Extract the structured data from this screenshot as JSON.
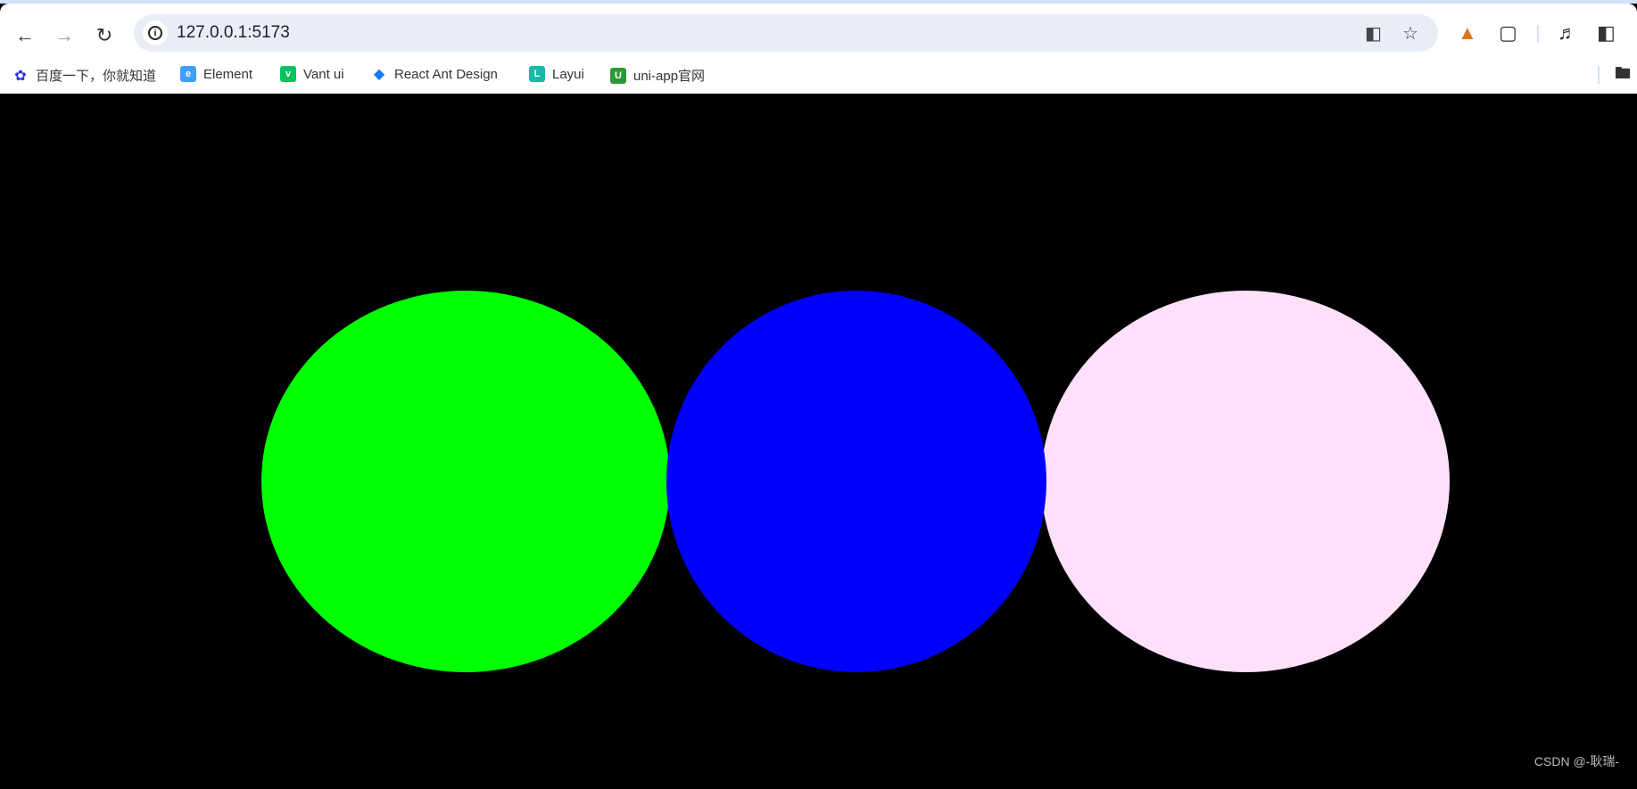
{
  "browser": {
    "url": "127.0.0.1:5173",
    "bookmarks": [
      {
        "label": "百度一下，你就知道",
        "icon": "baidu-icon",
        "color": "#2932e1"
      },
      {
        "label": "Element",
        "icon": "element-icon",
        "color": "#409eff"
      },
      {
        "label": "Vant ui",
        "icon": "vant-icon",
        "color": "#07c160"
      },
      {
        "label": "React Ant Design",
        "icon": "antd-icon",
        "color": "#1677ff"
      },
      {
        "label": "Layui",
        "icon": "layui-icon",
        "color": "#16baaa"
      },
      {
        "label": "uni-app官网",
        "icon": "uniapp-icon",
        "color": "#2b9939"
      }
    ]
  },
  "scene": {
    "background": "#000000",
    "circles": [
      {
        "name": "green-circle",
        "color": "#00ff00"
      },
      {
        "name": "pink-circle",
        "color": "#ffe0fa"
      },
      {
        "name": "blue-circle",
        "color": "#0000ff"
      }
    ]
  },
  "watermark": "CSDN @-耿瑞-"
}
